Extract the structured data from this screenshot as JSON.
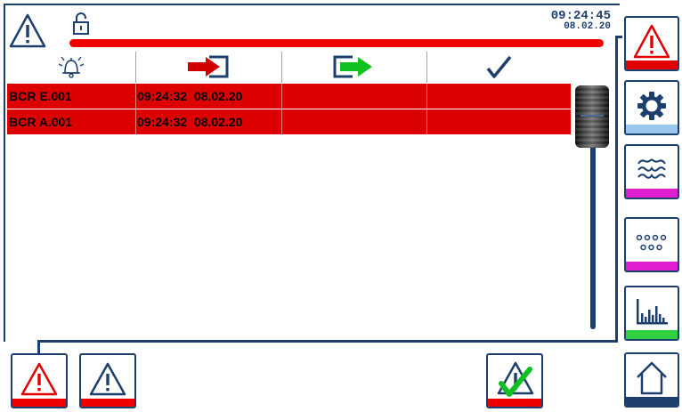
{
  "header": {
    "time": "09:24:45",
    "date": "08.02.20",
    "warning_icon": "warning-triangle-icon",
    "lock_icon": "unlocked-padlock-icon"
  },
  "table": {
    "columns": [
      {
        "icon": "alarm-bell-icon"
      },
      {
        "icon": "arrow-in-red-icon"
      },
      {
        "icon": "arrow-out-green-icon"
      },
      {
        "icon": "checkmark-icon"
      }
    ],
    "rows": [
      {
        "name": "BCR E.001",
        "time": "09:24:32  08.02.20"
      },
      {
        "name": "BCR A.001",
        "time": "09:24:32  08.02.20"
      }
    ]
  },
  "side_buttons": [
    {
      "icon": "alarm-warning-icon",
      "color": "#e00000"
    },
    {
      "icon": "gear-icon",
      "color": "#9cc8ef"
    },
    {
      "icon": "waves-icon",
      "color": "#e020d0"
    },
    {
      "icon": "dots-icon",
      "color": "#e020d0"
    },
    {
      "icon": "bar-chart-icon",
      "color": "#30d040"
    },
    {
      "icon": "home-icon",
      "color": "#1d3f6e"
    }
  ],
  "bottom_buttons": [
    {
      "icon": "warning-red-icon",
      "color": "#e00000"
    },
    {
      "icon": "warning-blue-icon",
      "color": "#e00000"
    },
    {
      "icon": "acknowledge-check-icon",
      "color": "#e00000"
    }
  ],
  "colors": {
    "frame": "#1d3f6e",
    "alarm_row": "#dd0000",
    "accent_red": "#e00000"
  }
}
